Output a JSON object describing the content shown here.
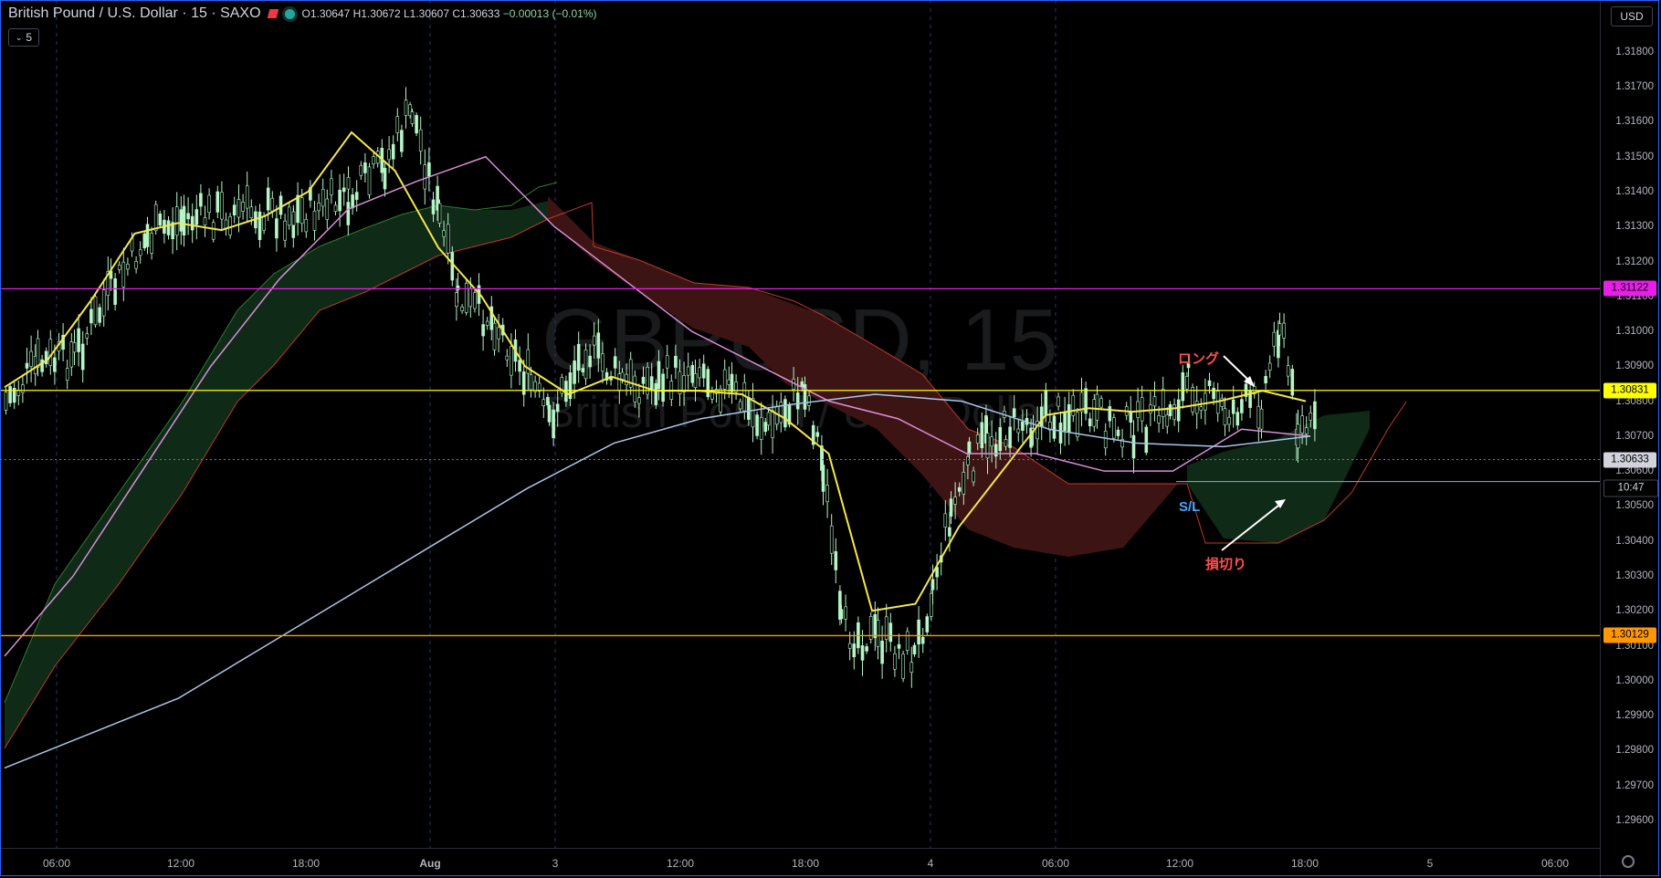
{
  "header": {
    "symbol": "British Pound / U.S. Dollar · 15 · SAXO",
    "ohlc": "O1.30647  H1.30672  L1.30607  C1.30633",
    "change": "−0.00013 (−0.01%)",
    "collapse_label": "5"
  },
  "watermark": {
    "symbol": "GBPUSD, 15",
    "name": "British Pound / U.S. Dollar"
  },
  "price_axis": {
    "currency_button": "USD",
    "ticks": [
      "1.31800",
      "1.31700",
      "1.31600",
      "1.31500",
      "1.31400",
      "1.31300",
      "1.31200",
      "1.31100",
      "1.31000",
      "1.30900",
      "1.30800",
      "1.30700",
      "1.30600",
      "1.30500",
      "1.30400",
      "1.30300",
      "1.30200",
      "1.30100",
      "1.30000",
      "1.29900",
      "1.29800",
      "1.29700",
      "1.29600"
    ],
    "price_tags": [
      {
        "price": 1.31122,
        "label": "1.31122",
        "bg": "#e91ee9",
        "fg": "#000000"
      },
      {
        "price": 1.30831,
        "label": "1.30831",
        "bg": "#ffff00",
        "fg": "#000000"
      },
      {
        "price": 1.30633,
        "label": "1.30633",
        "bg": "#d1d4dc",
        "fg": "#000000"
      },
      {
        "price": 1.30129,
        "label": "1.30129",
        "bg": "#ff9800",
        "fg": "#000000"
      }
    ],
    "countdown": "10:47"
  },
  "time_axis": {
    "labels": [
      "06:00",
      "12:00",
      "18:00",
      "Aug",
      "3",
      "12:00",
      "18:00",
      "4",
      "06:00",
      "12:00",
      "18:00",
      "5",
      "06:00"
    ]
  },
  "annotations": {
    "long_label": "ロング",
    "stop_label": "損切り",
    "sl_label": "S/L"
  },
  "colors": {
    "up": "#b5f5c6",
    "line_magenta": "#e91ee9",
    "line_yellow": "#ffff00",
    "line_orange": "#ff9800",
    "line_sl": "#6fb7e5",
    "ma_yellow": "#f5e84a",
    "ma_pink": "#d98fd8",
    "ma_blue": "#a8c6e8",
    "cloud_green": "#0f2a16",
    "cloud_red": "#3d1414"
  },
  "chart_data": {
    "type": "line",
    "title": "British Pound / U.S. Dollar · 15 · SAXO",
    "x_labels": [
      "06:00",
      "12:00",
      "18:00",
      "Aug",
      "3",
      "12:00",
      "18:00",
      "4",
      "06:00",
      "12:00",
      "18:00",
      "5",
      "06:00"
    ],
    "ylim": [
      1.2955,
      1.3192
    ],
    "grid": false,
    "horizontal_lines": [
      {
        "price": 1.31122
      },
      {
        "price": 1.30831
      },
      {
        "price": 1.30129
      },
      {
        "price": 1.3057,
        "label": "S/L"
      }
    ],
    "series": [
      {
        "values": [
          1.3084,
          1.3092,
          1.3109,
          1.3128,
          1.3131,
          1.3129,
          1.3133,
          1.314,
          1.3157,
          1.3146,
          1.3124,
          1.311,
          1.309,
          1.3082,
          1.3087,
          1.3083,
          1.3083,
          1.3082,
          1.3075,
          1.3065,
          1.302,
          1.3022,
          1.3044,
          1.306,
          1.3076,
          1.3078,
          1.3077,
          1.3078,
          1.308,
          1.3083,
          1.308
        ]
      },
      {
        "values": [
          1.3007,
          1.303,
          1.306,
          1.309,
          1.3115,
          1.3135,
          1.3143,
          1.315,
          1.313,
          1.3115,
          1.31,
          1.309,
          1.308,
          1.3075,
          1.3065,
          1.3065,
          1.306,
          1.306,
          1.3072,
          1.307
        ]
      },
      {
        "values": [
          1.2975,
          1.2985,
          1.2995,
          1.301,
          1.3025,
          1.304,
          1.3055,
          1.3068,
          1.3075,
          1.3079,
          1.3082,
          1.308,
          1.3072,
          1.3068,
          1.3067,
          1.307
        ]
      }
    ]
  }
}
